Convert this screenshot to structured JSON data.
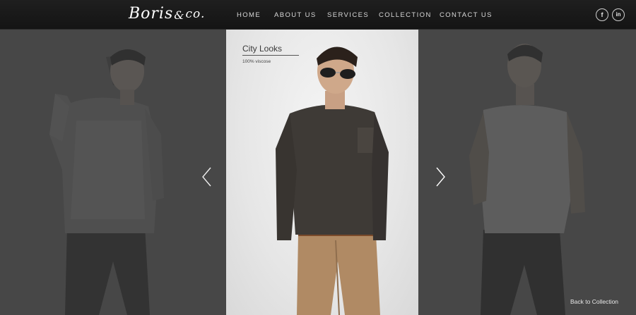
{
  "brand": {
    "logo_text": "Boris",
    "logo_amp": "&",
    "logo_suffix": "co."
  },
  "nav": {
    "items": [
      {
        "label": "HOME"
      },
      {
        "label": "ABOUT US"
      },
      {
        "label": "SERVICES"
      },
      {
        "label": "COLLECTION"
      },
      {
        "label": "CONTACT US"
      }
    ]
  },
  "social": {
    "facebook": "f",
    "linkedin": "in"
  },
  "product": {
    "title": "City Looks",
    "material": "100% viscose"
  },
  "footer": {
    "back_label": "Back to Collection"
  },
  "colors": {
    "header": "#1a1a1a",
    "side_panel": "#4a4a4a",
    "center_panel": "#e8e8e8",
    "nav_text": "#d8d8d8"
  },
  "icons": {
    "prev": "chevron-left-icon",
    "next": "chevron-right-icon"
  }
}
